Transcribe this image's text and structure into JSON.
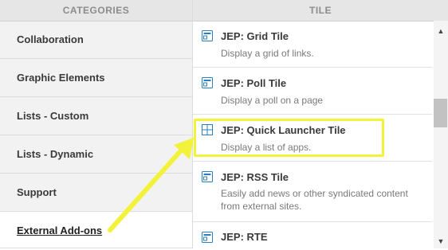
{
  "left_header": "CATEGORIES",
  "right_header": "TILE",
  "categories": [
    {
      "label": "Collaboration"
    },
    {
      "label": "Graphic Elements"
    },
    {
      "label": "Lists - Custom"
    },
    {
      "label": "Lists - Dynamic"
    },
    {
      "label": "Support"
    },
    {
      "label": "External Add-ons"
    }
  ],
  "tiles": [
    {
      "title": "JEP: Grid Tile",
      "desc": "Display a grid of links.",
      "icon": "tile-icon"
    },
    {
      "title": "JEP: Poll Tile",
      "desc": "Display a poll on a page",
      "icon": "tile-icon"
    },
    {
      "title": "JEP: Quick Launcher Tile",
      "desc": "Display a list of apps.",
      "icon": "grid-icon"
    },
    {
      "title": "JEP: RSS Tile",
      "desc": "Easily add news or other syndicated content from external sites.",
      "icon": "tile-icon"
    },
    {
      "title": "JEP: RTE",
      "desc": "",
      "icon": "tile-icon"
    }
  ],
  "colors": {
    "accent": "#2a7fc1",
    "highlight": "#f2f23a"
  }
}
